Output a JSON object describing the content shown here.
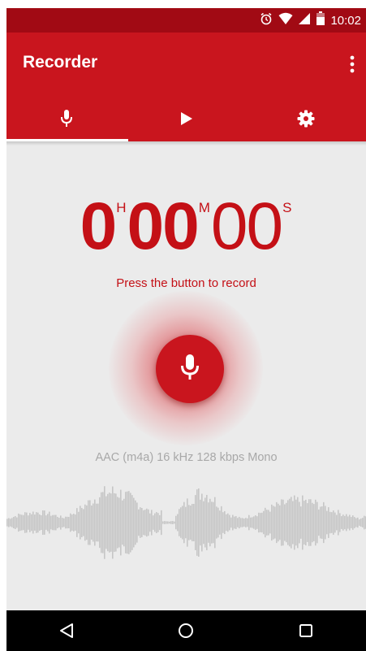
{
  "status_bar": {
    "time": "10:02",
    "icons": [
      "alarm-icon",
      "wifi-icon",
      "signal-icon",
      "battery-icon"
    ]
  },
  "app_bar": {
    "title": "Recorder",
    "overflow_icon": "more-vert-icon"
  },
  "tabs": [
    {
      "icon": "mic-icon",
      "selected": true
    },
    {
      "icon": "play-icon",
      "selected": false
    },
    {
      "icon": "gear-icon",
      "selected": false
    }
  ],
  "timer": {
    "hours": "0",
    "hours_unit": "H",
    "minutes": "00",
    "minutes_unit": "M",
    "seconds": "00",
    "seconds_unit": "S"
  },
  "prompt": "Press the button to record",
  "record_button": {
    "icon": "mic-icon"
  },
  "format_info": "AAC (m4a) 16 kHz 128 kbps Mono",
  "nav_bar": {
    "buttons": [
      "back-icon",
      "home-icon",
      "recents-icon"
    ]
  },
  "colors": {
    "status_bar": "#a10a14",
    "primary": "#c9151e",
    "accent_text": "#c41016",
    "background": "#ebebeb",
    "waveform": "#c6c6c6",
    "secondary_text": "#a8a8a8"
  }
}
